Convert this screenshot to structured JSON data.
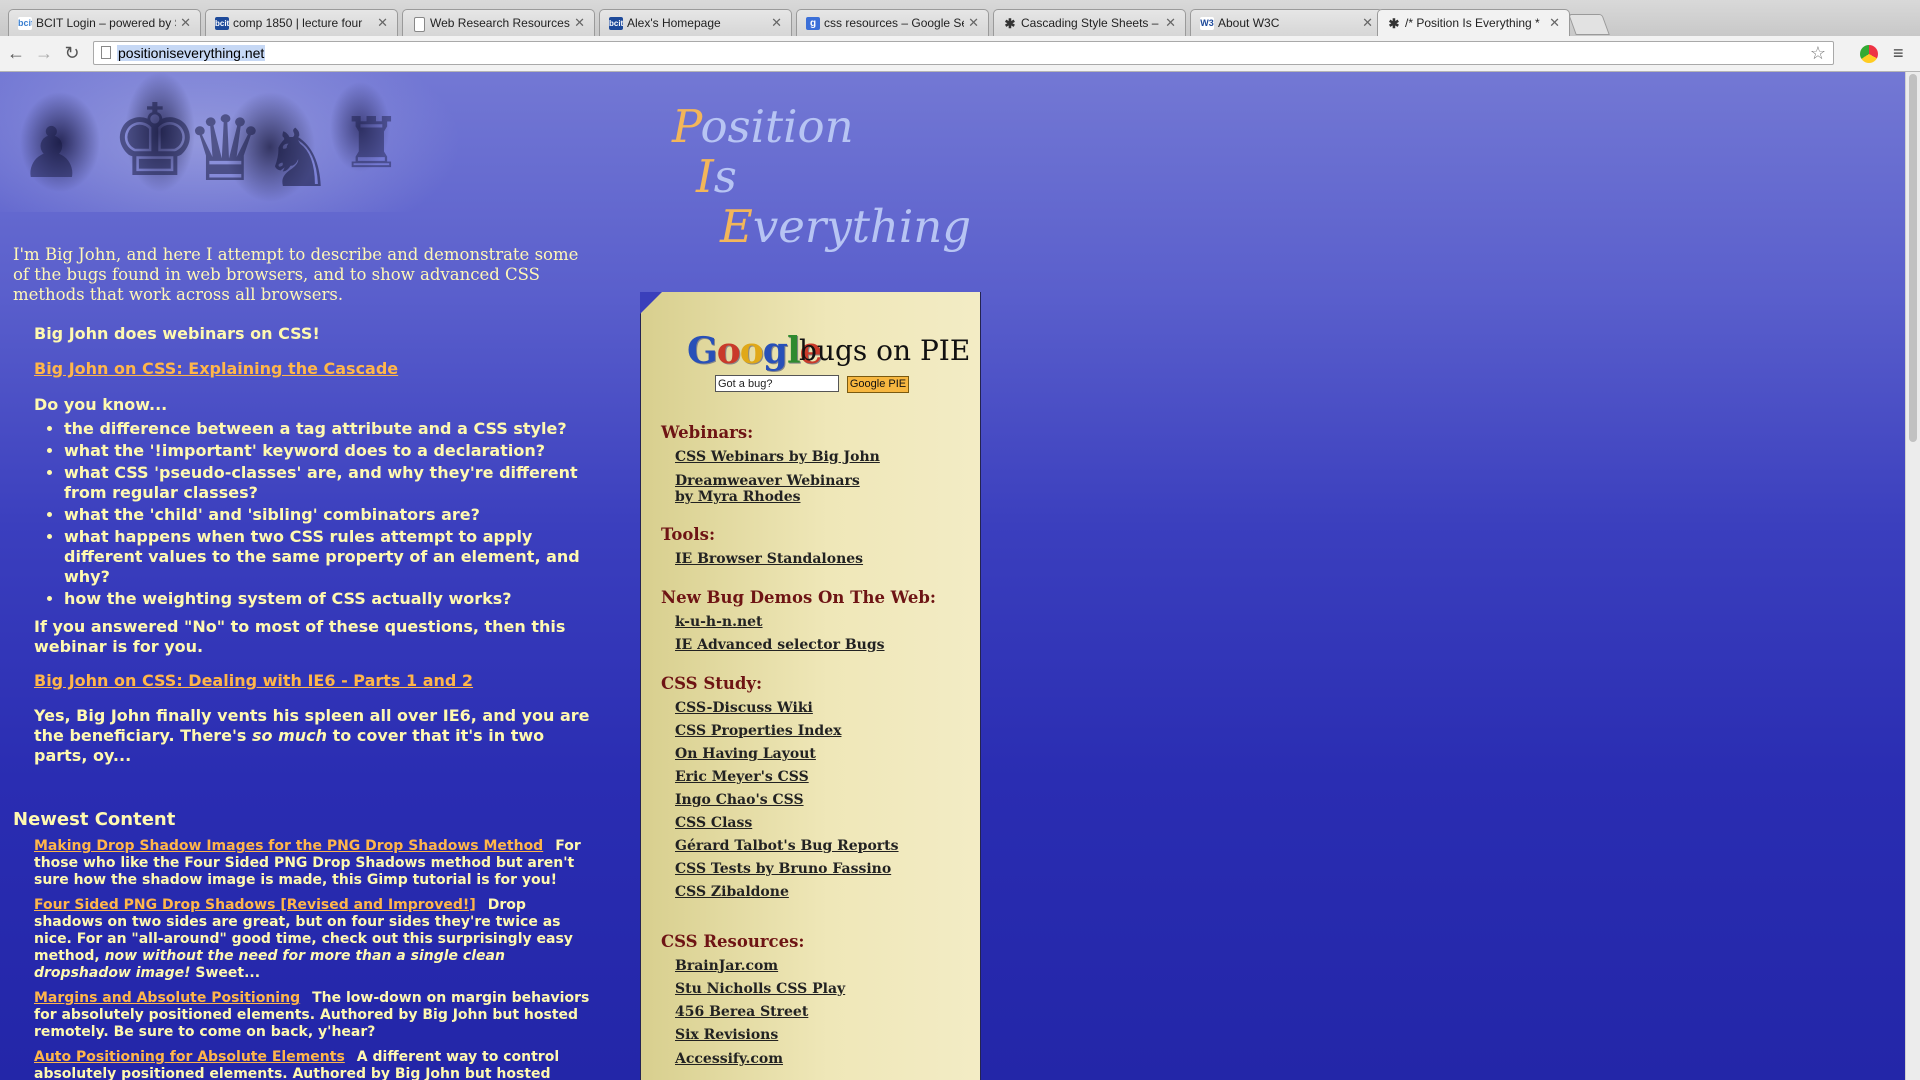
{
  "browser": {
    "tabs": [
      {
        "favicon": "bcit",
        "label": "BCIT Login – powered by S"
      },
      {
        "favicon": "bcit",
        "label": "comp 1850 | lecture four"
      },
      {
        "favicon": "page-icon",
        "label": "Web Research Resources"
      },
      {
        "favicon": "bcit",
        "label": "Alex's Homepage"
      },
      {
        "favicon": "google-icon",
        "label": "css resources – Google Se"
      },
      {
        "favicon": "bug-icon",
        "label": "Cascading Style Sheets – T"
      },
      {
        "favicon": "w3c-icon",
        "label": "About W3C"
      },
      {
        "favicon": "bug-icon",
        "label": "/* Position Is Everything *"
      }
    ],
    "url": "positioniseverything.net"
  },
  "page": {
    "logo": {
      "l1_cap": "P",
      "l1_rest": "osition",
      "l2_cap": "I",
      "l2_rest": "s",
      "l3_cap": "E",
      "l3_rest": "verything"
    },
    "intro": "I'm Big John, and here I attempt to describe and demonstrate some of the bugs found in web browsers, and to show advanced CSS methods that work across all browsers.",
    "webinars_heading": "Big John does webinars on CSS!",
    "link_cascade": "Big John on CSS: Explaining the Cascade",
    "do_you_know": "Do you know...",
    "dyk_items": [
      "the difference between a tag attribute and a CSS style?",
      "what the '!important' keyword does to a declaration?",
      "what CSS 'pseudo-classes' are, and why they're different from regular classes?",
      "what the 'child' and 'sibling' combinators are?",
      "what happens when two CSS rules attempt to apply different values to the same property of an element, and why?",
      "how the weighting system of CSS actually works?"
    ],
    "if_answered": "If you answered \"No\" to most of these questions, then this webinar is for you.",
    "link_ie6": "Big John on CSS: Dealing with IE6 - Parts 1 and 2",
    "ie6_text_1": "Yes, Big John finally vents his spleen all over IE6, and you are the beneficiary. There's ",
    "ie6_text_em": "so much",
    "ie6_text_2": " to cover that it's in two parts, oy...",
    "newest_heading": "Newest Content",
    "newest": [
      {
        "link": "Making Drop Shadow Images for the PNG Drop Shadows Method",
        "text": "For those who like the Four Sided PNG Drop Shadows method but aren't sure how the shadow image is made, this Gimp tutorial is for you!"
      },
      {
        "link": "Four Sided PNG Drop Shadows [Revised and Improved!]",
        "text": "Drop shadows on two sides are great, but on four sides they're twice as nice. For an \"all-around\" good time, check out this surprisingly easy method, ",
        "em": "now without the need for more than a single clean dropshadow image!",
        "tail": " Sweet..."
      },
      {
        "link": "Margins and Absolute Positioning",
        "text": "The low-down on margin behaviors for absolutely positioned elements. Authored by Big John but hosted remotely. Be sure to come on back, y'hear?"
      },
      {
        "link": "Auto Positioning for Absolute Elements",
        "text": "A different way to control absolutely positioned elements. Authored by Big John but hosted remotely."
      }
    ]
  },
  "sidebar": {
    "search_suffix": "bugs on PIE",
    "search_value": "Got a bug?",
    "search_button": "Google PIE",
    "sections": [
      {
        "title": "Webinars:",
        "links": [
          "CSS Webinars by Big John",
          "Dreamweaver Webinars|by Myra Rhodes"
        ]
      },
      {
        "title": "Tools:",
        "links": [
          "IE Browser Standalones"
        ]
      },
      {
        "title": "New Bug Demos On The Web:",
        "links": [
          "k-u-h-n.net",
          "IE Advanced selector Bugs"
        ]
      },
      {
        "title": "CSS Study:",
        "links": [
          "CSS-Discuss Wiki",
          "CSS Properties Index",
          "On Having Layout",
          "Eric Meyer's CSS",
          "Ingo Chao's CSS",
          "CSS Class",
          "Gérard Talbot's Bug Reports",
          "CSS Tests by Bruno Fassino",
          "CSS Zibaldone"
        ]
      },
      {
        "title": "CSS Resources:",
        "links": [
          "BrainJar.com",
          "Stu Nicholls CSS Play",
          "456 Berea Street",
          "Six Revisions",
          "Accessify.com"
        ]
      }
    ]
  },
  "colors": {
    "page_top": "#7378d4",
    "page_bottom": "#2326a8",
    "link_orange": "#ffb64a",
    "text_yellow": "#fff9b0",
    "sidebar_bg": "#efe7b8",
    "sidebar_heading": "#6e1414"
  }
}
